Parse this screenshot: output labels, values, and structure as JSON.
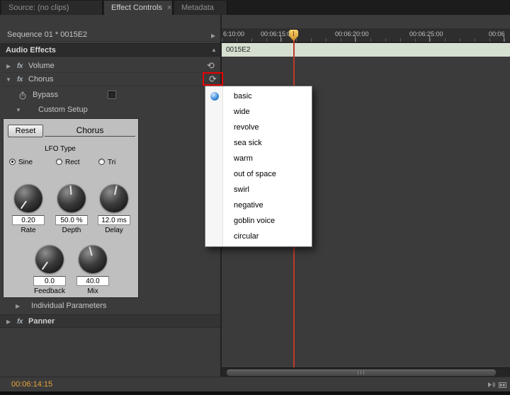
{
  "tabs": {
    "source": {
      "label": "Source: (no clips)"
    },
    "effect_controls": {
      "label": "Effect Controls",
      "close": "×"
    },
    "metadata": {
      "label": "Metadata"
    }
  },
  "icons": {
    "collapsed": "▶",
    "expanded": "▼",
    "reset": "⟲",
    "preset": "⟳",
    "panel_collapse": "▲",
    "show_timeline": "▶"
  },
  "effect_controls": {
    "sequence_title": "Sequence 01 * 0015E2",
    "group_header": "Audio Effects",
    "fx_badge": "fx",
    "effects": {
      "volume": "Volume",
      "chorus": "Chorus",
      "panner": "Panner"
    },
    "chorus_rows": {
      "bypass_label": "Bypass",
      "custom_setup_label": "Custom Setup",
      "individual_parameters_label": "Individual Parameters"
    }
  },
  "chorus_plugin": {
    "reset_label": "Reset",
    "title": "Chorus",
    "lfo_type_label": "LFO Type",
    "lfo_options": [
      {
        "label": "Sine",
        "selected": true
      },
      {
        "label": "Rect",
        "selected": false
      },
      {
        "label": "Tri",
        "selected": false
      }
    ],
    "knobs": [
      {
        "label": "Rate",
        "value": "0.20"
      },
      {
        "label": "Depth",
        "value": "50.0 %"
      },
      {
        "label": "Delay",
        "value": "12.0 ms"
      },
      {
        "label": "Feedback",
        "value": "0.0"
      },
      {
        "label": "Mix",
        "value": "40.0"
      }
    ]
  },
  "preset_menu": {
    "items": [
      {
        "label": "basic",
        "selected": true
      },
      {
        "label": "wide"
      },
      {
        "label": "revolve"
      },
      {
        "label": "sea sick"
      },
      {
        "label": "warm"
      },
      {
        "label": "out of space"
      },
      {
        "label": "swirl"
      },
      {
        "label": "negative"
      },
      {
        "label": "goblin voice"
      },
      {
        "label": "circular"
      }
    ]
  },
  "timeline": {
    "ruler_labels": [
      "6:10:00",
      "00:06:15:00",
      "00:06:20:00",
      "00:06:25:00",
      "00:06"
    ],
    "clip_label": "0015E2"
  },
  "statusbar": {
    "timecode": "00:06:14:15"
  },
  "colors": {
    "accent_red": "#e80000",
    "timecode_orange": "#e8a53c",
    "clip_green": "#d6e0d1",
    "playhead_red": "#bf3a2b",
    "preset_dot_blue": "#2e7fd6"
  }
}
